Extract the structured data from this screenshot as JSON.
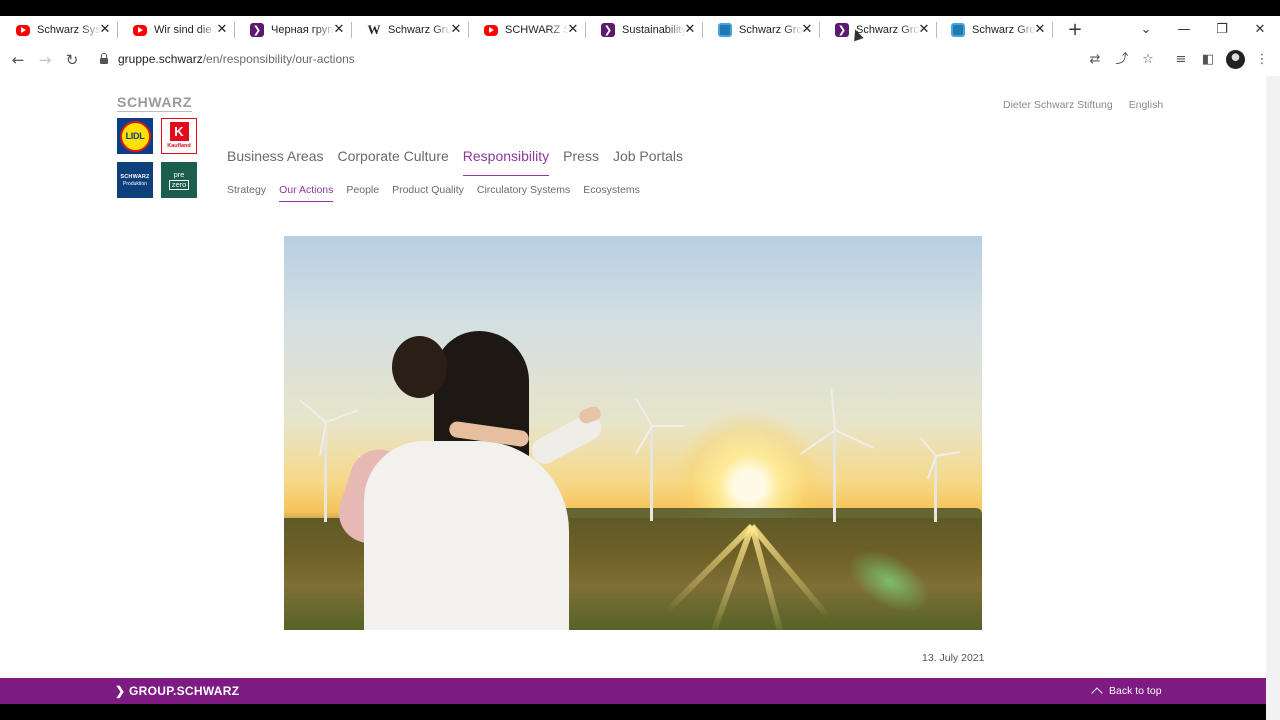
{
  "browser": {
    "tabs": [
      {
        "title": "Schwarz Syste",
        "favicon": "youtube-icon"
      },
      {
        "title": "Wir sind die S",
        "favicon": "youtube-icon"
      },
      {
        "title": "Черная групп",
        "favicon": "schwarz-icon"
      },
      {
        "title": "Schwarz Grupp",
        "favicon": "wikipedia-icon"
      },
      {
        "title": "SCHWARZ Sp",
        "favicon": "youtube-icon"
      },
      {
        "title": "Sustainability",
        "favicon": "schwarz-icon"
      },
      {
        "title": "Schwarz Grou",
        "favicon": "site-icon"
      },
      {
        "title": "Schwarz Grou",
        "favicon": "schwarz-icon"
      },
      {
        "title": "Schwarz Grou",
        "favicon": "site-icon"
      }
    ],
    "close_glyph": "✕",
    "new_tab_glyph": "+",
    "window_controls": {
      "dropdown": "⌄",
      "minimize": "—",
      "restore": "❐",
      "close": "✕"
    },
    "nav": {
      "back": "←",
      "forward": "→",
      "reload": "↻"
    },
    "url": {
      "host": "gruppe.schwarz",
      "path": "/en/responsibility/our-actions"
    },
    "toolbar_icons": {
      "translate": "⇄",
      "share": "⤴",
      "bookmark": "☆",
      "reading_list": "≡",
      "side_panel": "◧",
      "menu": "⋮"
    }
  },
  "site": {
    "wordmark": "SCHWARZ",
    "brands": {
      "lidl": "LIDL",
      "kaufland_letter": "K",
      "kaufland": "Kaufland",
      "schwarz_produktion_a": "SCHWARZ",
      "schwarz_produktion_b": "Produktion",
      "prezero_a": "pre",
      "prezero_b": "zero"
    },
    "main_nav": [
      "Business Areas",
      "Corporate Culture",
      "Responsibility",
      "Press",
      "Job Portals"
    ],
    "main_nav_active": "Responsibility",
    "sub_nav": [
      "Strategy",
      "Our Actions",
      "People",
      "Product Quality",
      "Circulatory Systems",
      "Ecosystems"
    ],
    "sub_nav_active": "Our Actions",
    "utility_nav": [
      "Dieter Schwarz Stiftung",
      "English"
    ],
    "date": "13. July 2021",
    "footer": {
      "logo": "❯ GROUP.SCHWARZ",
      "back_to_top": "Back to top"
    }
  },
  "colors": {
    "accent": "#7d1b82",
    "active_link": "#8c3a9b",
    "text_grey": "#6a6a6a"
  }
}
